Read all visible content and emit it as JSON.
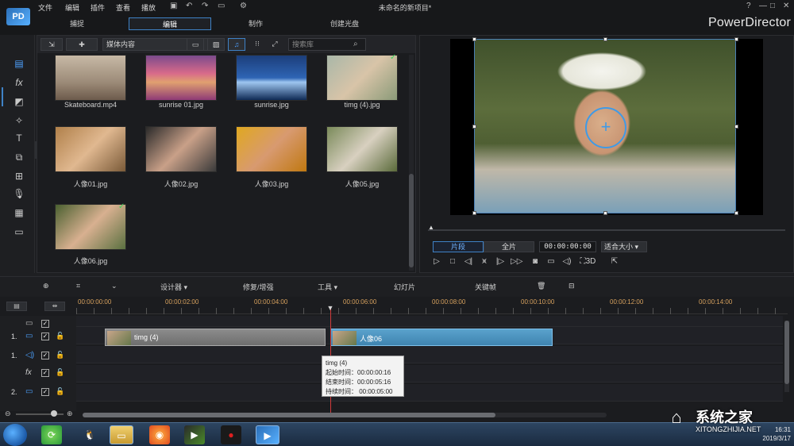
{
  "window": {
    "title": "未命名的新项目*",
    "brand": "PowerDirector",
    "logo_text": "PD",
    "menu": [
      "文件",
      "编辑",
      "插件",
      "查看",
      "播放"
    ],
    "controls": [
      "?",
      "—",
      "□",
      "✕"
    ]
  },
  "modes": [
    "捕捉",
    "编辑",
    "制作",
    "创建光盘"
  ],
  "library": {
    "dropdown": "媒体内容",
    "search_placeholder": "搜索库",
    "items": [
      {
        "label": "Skateboard.mp4",
        "checked": false
      },
      {
        "label": "sunrise 01.jpg",
        "checked": false
      },
      {
        "label": "sunrise.jpg",
        "checked": false
      },
      {
        "label": "timg (4).jpg",
        "checked": true
      },
      {
        "label": "人像01.jpg",
        "checked": false
      },
      {
        "label": "人像02.jpg",
        "checked": false
      },
      {
        "label": "人像03.jpg",
        "checked": false
      },
      {
        "label": "人像05.jpg",
        "checked": false
      },
      {
        "label": "人像06.jpg",
        "checked": true
      }
    ]
  },
  "preview": {
    "tab_clip": "片段",
    "tab_full": "全片",
    "timecode": "00:00:00:00",
    "fit": "适合大小",
    "mode_3d": "3D"
  },
  "timeline_toolbar": {
    "designer": "设计器",
    "fix": "修复/增强",
    "tools": "工具",
    "slideshow": "幻灯片",
    "keyframe": "关键帧"
  },
  "timeline": {
    "ticks": [
      "00:00:00:00",
      "00:00:02:00",
      "00:00:04:00",
      "00:00:06:00",
      "00:00:08:00",
      "00:00:10:00",
      "00:00:12:00",
      "00:00:14:00"
    ],
    "tracks": [
      {
        "num": "",
        "type": "video"
      },
      {
        "num": "1.",
        "type": "video"
      },
      {
        "num": "1.",
        "type": "audio"
      },
      {
        "num": "",
        "type": "fx"
      },
      {
        "num": "2.",
        "type": "video"
      }
    ],
    "clips": [
      {
        "label": "timg (4)"
      },
      {
        "label": "人像06"
      }
    ],
    "tooltip": {
      "name": "timg (4)",
      "start": "起始时间：00:00:00:16",
      "end": "结束时间：00:00:05:16",
      "duration": "持续时间：  00:00:05:00"
    }
  },
  "taskbar": {
    "time": "16:31",
    "date": "2019/3/17"
  },
  "watermark": {
    "text": "系统之家",
    "url": "XITONGZHIJIA.NET"
  }
}
